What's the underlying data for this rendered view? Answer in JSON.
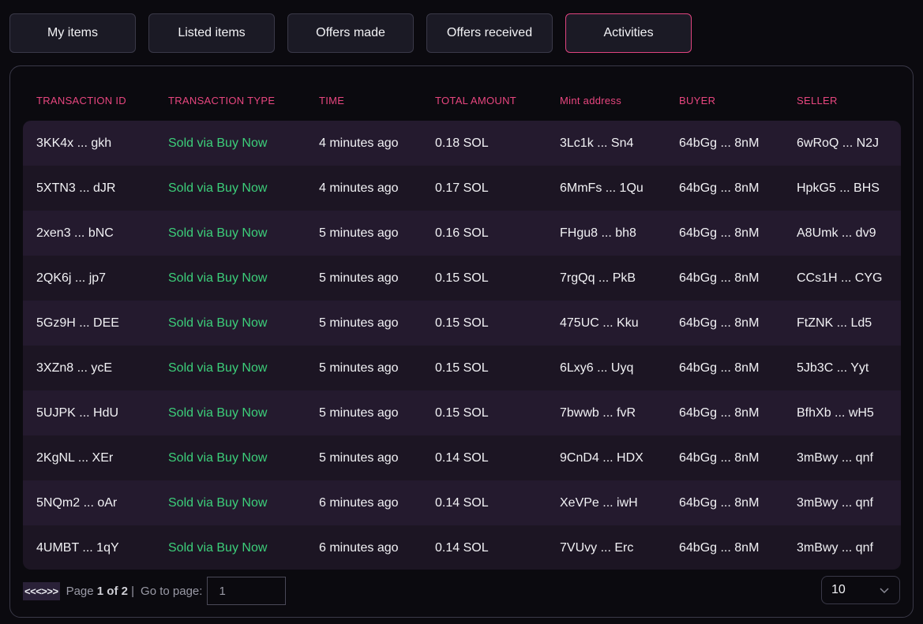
{
  "tabs": [
    {
      "label": "My items",
      "active": false
    },
    {
      "label": "Listed items",
      "active": false
    },
    {
      "label": "Offers made",
      "active": false
    },
    {
      "label": "Offers received",
      "active": false
    },
    {
      "label": "Activities",
      "active": true
    }
  ],
  "colors": {
    "accent": "#e8467f",
    "success": "#3ccf7a",
    "background": "#0b0a0f"
  },
  "table": {
    "columns": [
      "TRANSACTION ID",
      "TRANSACTION TYPE",
      "TIME",
      "TOTAL AMOUNT",
      "Mint address",
      "BUYER",
      "SELLER"
    ],
    "rows": [
      [
        "3KK4x ... gkh",
        "Sold via Buy Now",
        "4 minutes ago",
        "0.18 SOL",
        "3Lc1k ... Sn4",
        "64bGg ... 8nM",
        "6wRoQ ... N2J"
      ],
      [
        "5XTN3 ... dJR",
        "Sold via Buy Now",
        "4 minutes ago",
        "0.17 SOL",
        "6MmFs ... 1Qu",
        "64bGg ... 8nM",
        "HpkG5 ... BHS"
      ],
      [
        "2xen3 ... bNC",
        "Sold via Buy Now",
        "5 minutes ago",
        "0.16 SOL",
        "FHgu8 ... bh8",
        "64bGg ... 8nM",
        "A8Umk ... dv9"
      ],
      [
        "2QK6j ... jp7",
        "Sold via Buy Now",
        "5 minutes ago",
        "0.15 SOL",
        "7rgQq ... PkB",
        "64bGg ... 8nM",
        "CCs1H ... CYG"
      ],
      [
        "5Gz9H ... DEE",
        "Sold via Buy Now",
        "5 minutes ago",
        "0.15 SOL",
        "475UC ... Kku",
        "64bGg ... 8nM",
        "FtZNK ... Ld5"
      ],
      [
        "3XZn8 ... ycE",
        "Sold via Buy Now",
        "5 minutes ago",
        "0.15 SOL",
        "6Lxy6 ... Uyq",
        "64bGg ... 8nM",
        "5Jb3C ... Yyt"
      ],
      [
        "5UJPK ... HdU",
        "Sold via Buy Now",
        "5 minutes ago",
        "0.15 SOL",
        "7bwwb ... fvR",
        "64bGg ... 8nM",
        "BfhXb ... wH5"
      ],
      [
        "2KgNL ... XEr",
        "Sold via Buy Now",
        "5 minutes ago",
        "0.14 SOL",
        "9CnD4 ... HDX",
        "64bGg ... 8nM",
        "3mBwy ... qnf"
      ],
      [
        "5NQm2 ... oAr",
        "Sold via Buy Now",
        "6 minutes ago",
        "0.14 SOL",
        "XeVPe ... iwH",
        "64bGg ... 8nM",
        "3mBwy ... qnf"
      ],
      [
        "4UMBT ... 1qY",
        "Sold via Buy Now",
        "6 minutes ago",
        "0.14 SOL",
        "7VUvy ... Erc",
        "64bGg ... 8nM",
        "3mBwy ... qnf"
      ]
    ]
  },
  "pager": {
    "first": "<<",
    "prev": "<",
    "next": ">",
    "last": ">>",
    "page_prefix": "Page",
    "page_status": "1 of 2",
    "separator": "|",
    "goto_label": "Go to page:",
    "goto_value": "1",
    "page_size": "10"
  }
}
